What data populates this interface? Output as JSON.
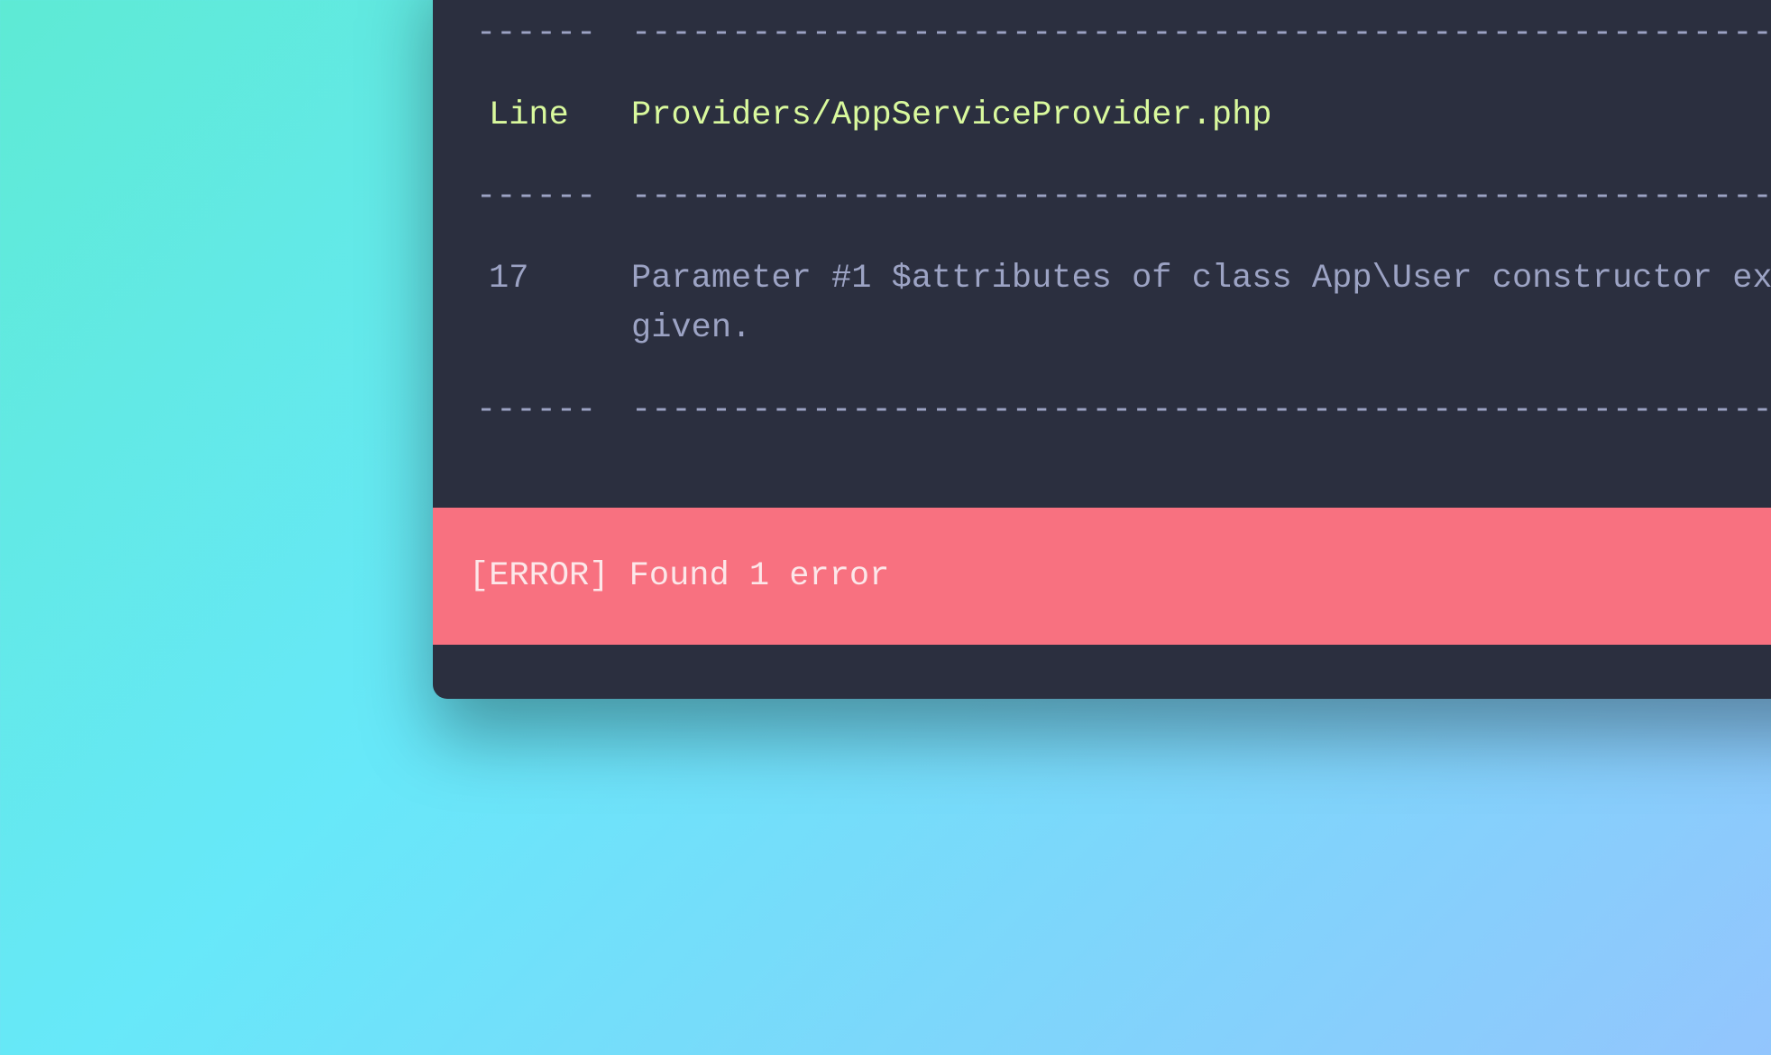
{
  "separators": {
    "col1": "------",
    "col2": "-----------------------------------------------------------------------------------------------------------------"
  },
  "table": {
    "header": {
      "line_label": "Line",
      "file_path": "Providers/AppServiceProvider.php"
    },
    "rows": [
      {
        "line": "17",
        "message": "Parameter #1 $attributes of class App\\User constructor expects array, string given."
      }
    ]
  },
  "error_banner": {
    "prefix": "[ERROR]",
    "message": "Found 1 error"
  }
}
